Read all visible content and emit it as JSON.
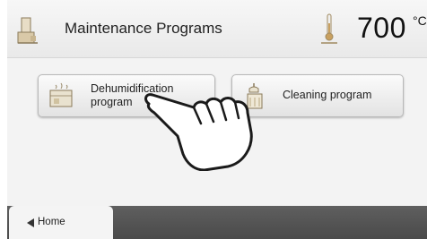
{
  "header": {
    "title": "Maintenance Programs",
    "temperature_value": "700",
    "temperature_unit": "°C"
  },
  "programs": [
    {
      "label": "Dehumidification\nprogram",
      "icon": "dehumidification-icon"
    },
    {
      "label": "Cleaning program",
      "icon": "cleaning-icon"
    }
  ],
  "footer": {
    "home_label": "Home",
    "home_icon": "back-arrow-icon"
  },
  "colors": {
    "bottom_bar": "#555555",
    "background": "#f1f1f1"
  }
}
